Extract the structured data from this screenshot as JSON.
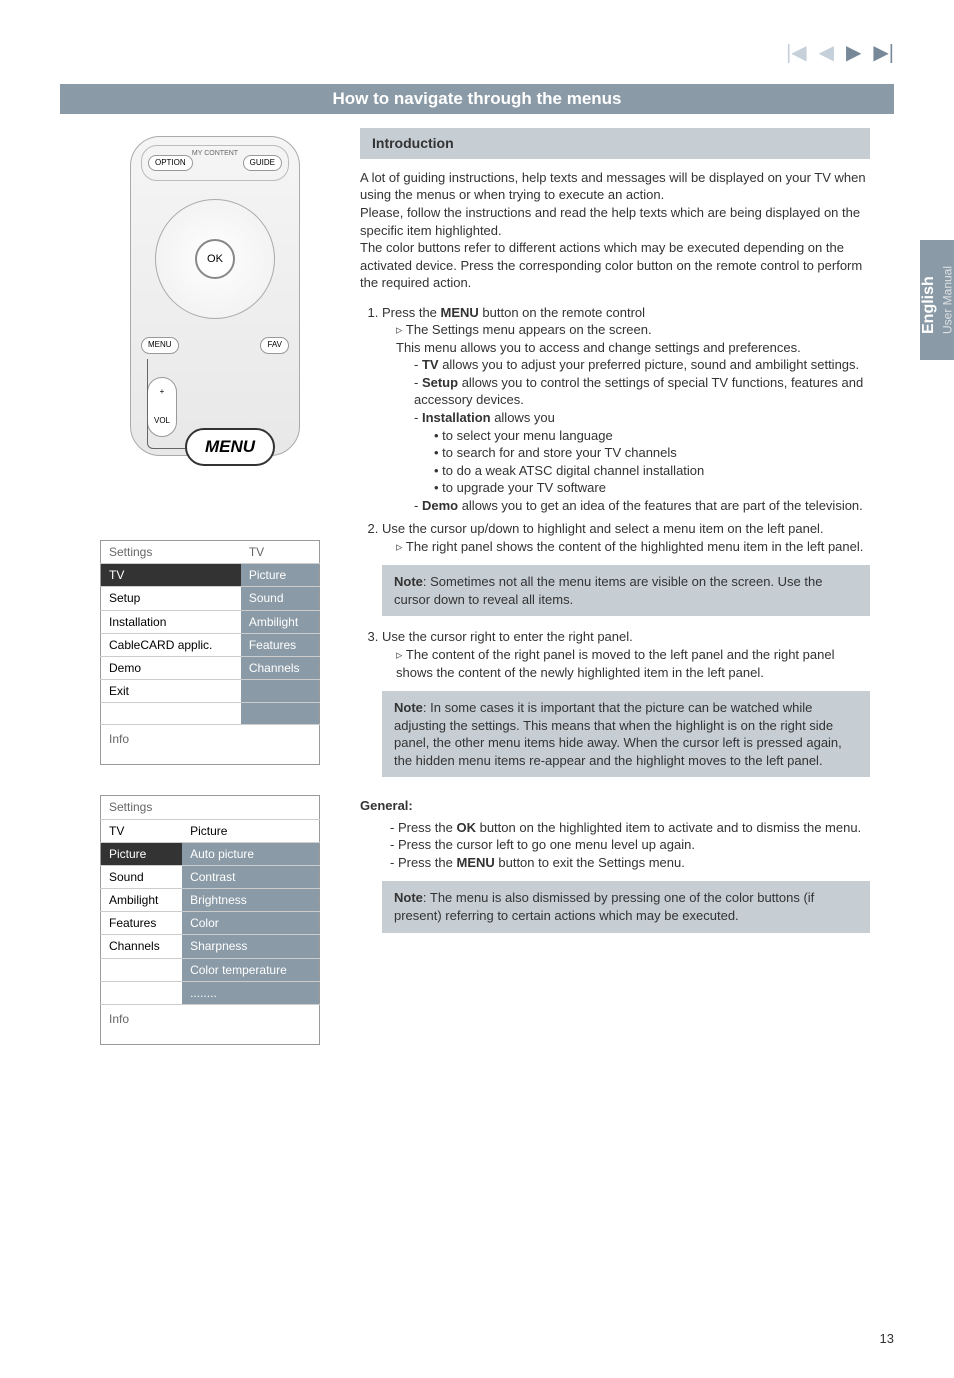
{
  "nav": {
    "first": "|◀",
    "prev": "◀",
    "next": "▶",
    "last": "▶|"
  },
  "header": "How to navigate through the menus",
  "sidetab": {
    "lang": "English",
    "sub": "User Manual"
  },
  "remote": {
    "mycontent": "MY CONTENT",
    "option": "OPTION",
    "guide": "GUIDE",
    "ok": "OK",
    "menu": "MENU",
    "fav": "FAV",
    "vol_plus": "+",
    "vol": "VOL",
    "callout": "MENU"
  },
  "table1": {
    "head_l": "Settings",
    "head_r": "TV",
    "rows_l": [
      "TV",
      "Setup",
      "Installation",
      "CableCARD applic.",
      "Demo",
      "Exit",
      ""
    ],
    "rows_r": [
      "Picture",
      "Sound",
      "Ambilight",
      "Features",
      "Channels",
      "",
      ""
    ],
    "info": "Info"
  },
  "table2": {
    "head_l": "Settings",
    "head_r": "",
    "sub_l": "TV",
    "sub_r": "Picture",
    "rows_l": [
      "Picture",
      "Sound",
      "Ambilight",
      "Features",
      "Channels",
      ""
    ],
    "rows_r": [
      "Auto picture",
      "Contrast",
      "Brightness",
      "Color",
      "Sharpness",
      "Color temperature",
      "........"
    ],
    "info": "Info"
  },
  "intro_h": "Introduction",
  "intro_p1": "A lot of guiding instructions, help texts and messages will be displayed on your TV when using the menus or when trying to execute an action.",
  "intro_p2": "Please, follow the instructions and read the help texts which are being displayed on the specific item highlighted.",
  "intro_p3": "The color buttons refer to different actions which may be executed depending on the activated device. Press the corresponding color button on the remote control to perform the required action.",
  "step1": "Press the ",
  "step1b": "MENU",
  "step1c": " button on the remote control",
  "step1_tri": "The Settings menu appears on the screen.",
  "step1_sub": "This menu allows you to access and change settings and preferences.",
  "dash_tv_b": "TV",
  "dash_tv": " allows you to adjust your preferred picture, sound and ambilight settings.",
  "dash_setup_b": "Setup",
  "dash_setup": " allows you to control the settings of special TV functions, features and accessory devices.",
  "dash_inst_b": "Installation",
  "dash_inst": " allows you",
  "dot1": "to select your menu language",
  "dot2": "to search for and store your TV channels",
  "dot3": "to do a weak ATSC digital channel installation",
  "dot4": "to upgrade your TV software",
  "dash_demo_b": "Demo",
  "dash_demo": " allows you to get an idea of the features that are part of the television.",
  "step2": "Use the cursor up/down to highlight and select a menu item on the left panel.",
  "step2_tri": "The right panel shows the content of the highlighted menu item in the left panel.",
  "note1_b": "Note",
  "note1": ": Sometimes not all the menu items are visible on the screen. Use the cursor down to reveal all items.",
  "step3": "Use the cursor right to enter the right panel.",
  "step3_tri": "The content of the right panel is moved to the left panel and the right panel shows the content of the newly highlighted item in the left panel.",
  "note2_b": "Note",
  "note2": ": In some cases it is important that the picture can be watched while adjusting the settings. This means that when the highlight is on the right side panel, the other menu items hide away. When the cursor left is pressed again, the hidden menu items re-appear and the highlight moves to the left panel.",
  "general_h": "General:",
  "gen1a": "Press the ",
  "gen1b": "OK",
  "gen1c": " button on the highlighted item to activate and to dismiss the menu.",
  "gen2": "Press the cursor left to go one menu level up again.",
  "gen3a": "Press the ",
  "gen3b": "MENU",
  "gen3c": " button to exit the Settings menu.",
  "note3_b": "Note",
  "note3": ": The menu is also dismissed by pressing one of the color buttons (if present) referring to certain actions which may be executed.",
  "page": "13"
}
